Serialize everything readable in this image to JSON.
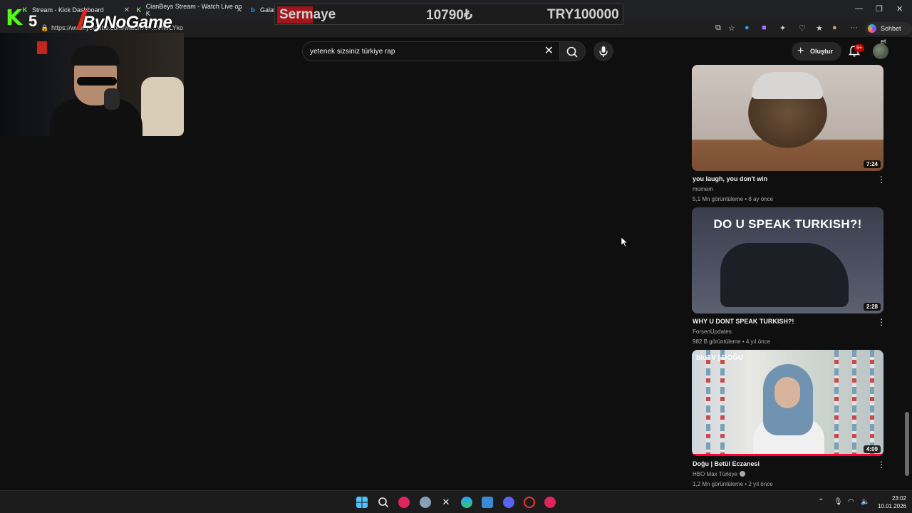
{
  "browser": {
    "tabs": [
      {
        "label": "Stream - Kick Dashboard"
      },
      {
        "label": "CianBeys Stream - Watch Live on K"
      },
      {
        "label": "Galat"
      }
    ],
    "url": "https://www.youtube.com/watch?v=...VfWLYko",
    "chat_button_label": "Sohbet et"
  },
  "overlay": {
    "brand_k": "K",
    "brand_number": "5",
    "brand_name": "ByNoGame",
    "sermaye_label": "Sermaye",
    "sermaye_value": "10790₺",
    "sermaye_goal": "TRY100000"
  },
  "youtube": {
    "search_query": "yetenek sizsiniz türkiye rap",
    "create_label": "Oluştur",
    "notification_count": "9+",
    "videos": [
      {
        "title": "you laugh, you don't win",
        "channel": "momem",
        "meta": "5,1 Mn görüntüleme • 8 ay önce",
        "duration": "7:24"
      },
      {
        "title": "WHY U DONT SPEAK TURKISH?!",
        "channel": "ForsenUpdates",
        "meta": "982 B görüntüleme • 4 yıl önce",
        "duration": "2:28",
        "thumb_text": "DO U SPEAK TURKISH?!"
      },
      {
        "title": "Doğu | Betül Eczanesi",
        "channel": "HBO Max Türkiye",
        "meta": "1,2 Mn görüntüleme • 2 yıl önce",
        "duration": "4:09",
        "thumb_text": "bluTV | DOĞU"
      }
    ]
  },
  "taskbar": {
    "time": "23:02",
    "date": "10.01.2026"
  },
  "colors": {
    "youtube_bg": "#0f0f0f",
    "kick_green": "#53fc18",
    "sermaye_red": "#a3141b",
    "progress_red": "#ff0033"
  }
}
